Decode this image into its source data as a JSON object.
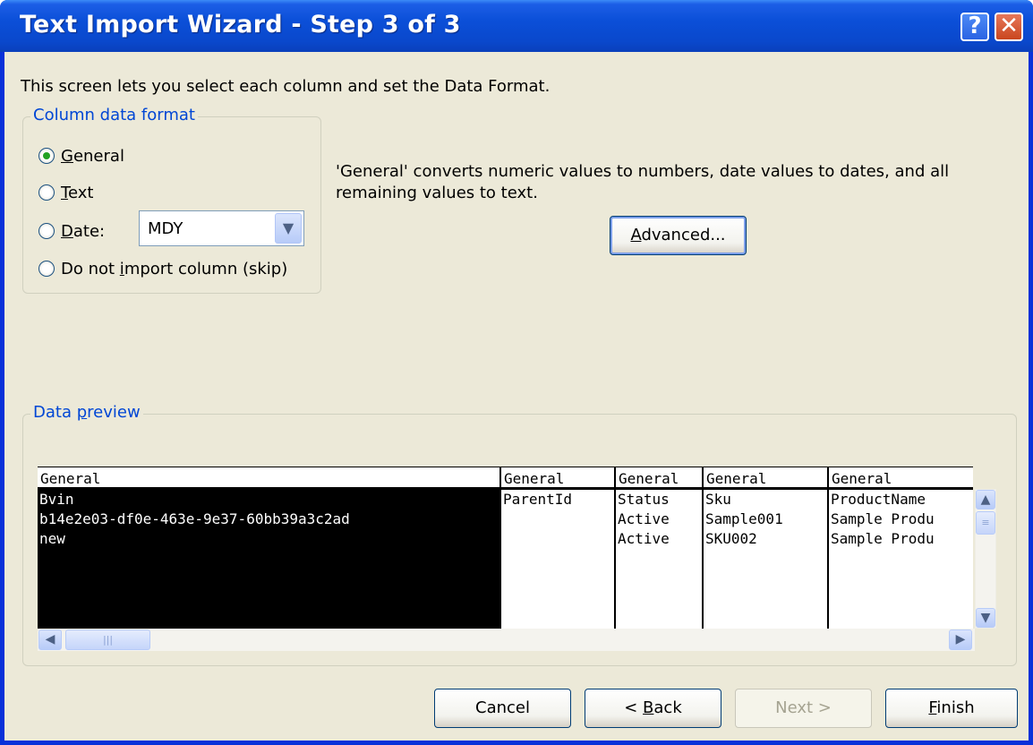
{
  "window": {
    "title": "Text Import Wizard - Step 3 of 3",
    "help_label": "?",
    "close_label": "✕"
  },
  "intro_text": "This screen lets you select each column and set the Data Format.",
  "column_format": {
    "group_title": "Column data format",
    "options": [
      {
        "label_prefix": "",
        "accel": "G",
        "label_rest": "eneral",
        "checked": true
      },
      {
        "label_prefix": "",
        "accel": "T",
        "label_rest": "ext",
        "checked": false
      },
      {
        "label_prefix": "",
        "accel": "D",
        "label_rest": "ate:",
        "checked": false
      },
      {
        "label_prefix": "Do not ",
        "accel": "i",
        "label_rest": "mport column (skip)",
        "checked": false
      }
    ],
    "date_value": "MDY"
  },
  "description": "'General' converts numeric values to numbers, date values to dates, and all remaining values to text.",
  "advanced_button": {
    "accel": "A",
    "rest": "dvanced..."
  },
  "preview": {
    "group_title_prefix": "Data ",
    "group_title_accel": "p",
    "group_title_rest": "review",
    "columns": [
      {
        "header": "General",
        "cells": [
          "Bvin",
          "b14e2e03-df0e-463e-9e37-60bb39a3c2ad",
          "new"
        ],
        "selected": true
      },
      {
        "header": "General",
        "cells": [
          "ParentId",
          "",
          ""
        ],
        "selected": false
      },
      {
        "header": "General",
        "cells": [
          "Status",
          "Active",
          "Active"
        ],
        "selected": false
      },
      {
        "header": "General",
        "cells": [
          "Sku",
          "Sample001",
          "SKU002"
        ],
        "selected": false
      },
      {
        "header": "General",
        "cells": [
          "ProductName",
          "Sample Produ",
          "Sample Produ"
        ],
        "selected": false
      }
    ]
  },
  "buttons": {
    "cancel": "Cancel",
    "back_prefix": "< ",
    "back_accel": "B",
    "back_rest": "ack",
    "next": "Next >",
    "finish_accel": "F",
    "finish_rest": "inish"
  }
}
